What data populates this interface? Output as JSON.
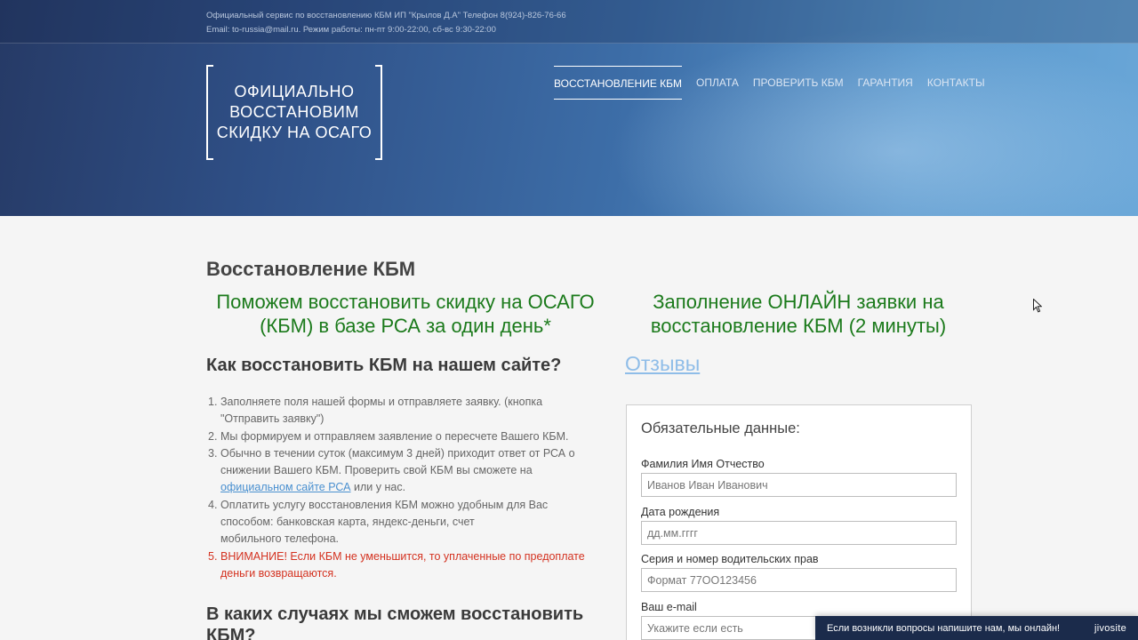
{
  "topbar": {
    "line1": "Официальный сервис по восстановлению КБМ ИП \"Крылов Д.А\" Телефон 8(924)-826-76-66",
    "line2": "Email: to-russia@mail.ru. Режим работы: пн-пт 9:00-22:00, сб-вс 9:30-22:00"
  },
  "logo": {
    "text": "ОФИЦИАЛЬНО ВОССТАНОВИМ СКИДКУ НА ОСАГО"
  },
  "nav": {
    "items": [
      {
        "label": "Восстановление КБМ"
      },
      {
        "label": "Оплата"
      },
      {
        "label": "Проверить КБМ"
      },
      {
        "label": "Гарантия"
      },
      {
        "label": "Контакты"
      }
    ]
  },
  "colors": {
    "accent_green": "#1b7a1b",
    "warning_red": "#d43220",
    "link_blue": "#4a90d0"
  },
  "main": {
    "title": "Восстановление КБМ",
    "headline_left": "Поможем восстановить скидку на ОСАГО (КБМ) в базе РСА за один день*",
    "headline_right": "Заполнение ОНЛАЙН заявки на восстановление КБМ (2 минуты)",
    "reviews_link": "Отзывы",
    "howto_title": "Как восстановить КБМ на нашем сайте?",
    "steps": [
      {
        "num": "1.",
        "text": "Заполняете поля нашей формы и отправляете заявку. (кнопка \"Отправить заявку\")"
      },
      {
        "num": "2.",
        "text": "Мы формируем и отправляем заявление о пересчете Вашего КБМ."
      },
      {
        "num": "3.",
        "text_before": "Обычно в течении суток (максимум 3 дней) приходит ответ от РСА о снижении Вашего КБМ. Проверить свой КБМ вы сможете на ",
        "link": "официальном сайте РСА",
        "text_after": " или у нас."
      },
      {
        "num": "4.",
        "text": "Оплатить услугу восстановления КБМ  можно удобным для Вас способом: банковская карта, яндекс-деньги, счет",
        "text2": "мобильного телефона."
      },
      {
        "num": "5.",
        "text": "ВНИМАНИЕ! Если КБМ не уменьшится, то уплаченные по предоплате деньги возвращаются."
      }
    ],
    "cases_title": "В каких случаях мы сможем восстановить КБМ?"
  },
  "form": {
    "title": "Обязательные данные:",
    "fields": [
      {
        "label": "Фамилия Имя Отчество",
        "placeholder": "Иванов Иван Иванович"
      },
      {
        "label": "Дата рождения",
        "placeholder": "дд.мм.гггг"
      },
      {
        "label": "Серия и номер водительских прав",
        "placeholder": "Формат 77ОО123456"
      },
      {
        "label": "Ваш e-mail",
        "placeholder": "Укажите если есть"
      }
    ]
  },
  "chat": {
    "text": "Если возникли вопросы напишите нам, мы онлайн!",
    "brand": "jivosite"
  }
}
